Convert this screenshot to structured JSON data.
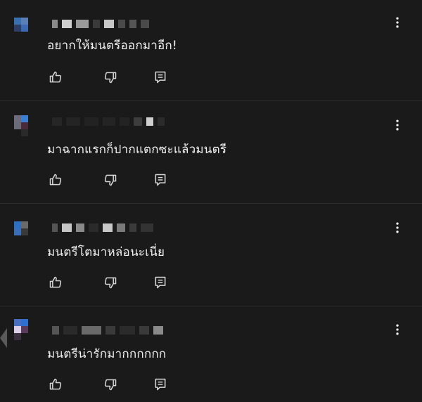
{
  "comments": [
    {
      "text": "อยากให้มนตรีออกมาอีก!"
    },
    {
      "text": "มาฉากแรกก็ปากแตกซะแล้วมนตรี"
    },
    {
      "text": "มนตรีโตมาหล่อนะเนี่ย"
    },
    {
      "text": "มนตรีน่ารักมากกกกกก"
    }
  ],
  "icons": {
    "like": "thumbs-up-icon",
    "dislike": "thumbs-down-icon",
    "reply": "reply-comment-icon",
    "more": "more-vertical-icon"
  },
  "colors": {
    "background": "#1a1a1a",
    "text": "#f1f1f1",
    "icon": "#d8d8d8",
    "divider": "#2e2e2e"
  }
}
